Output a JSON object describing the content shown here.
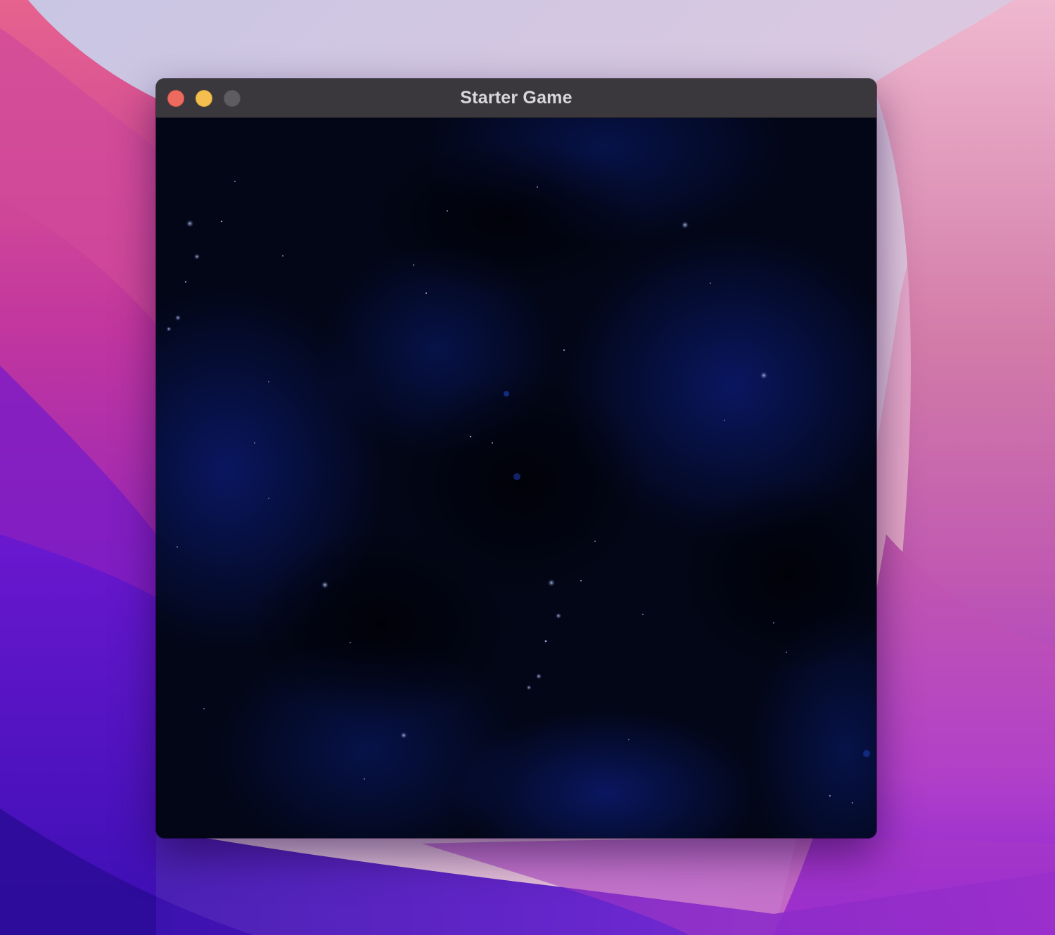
{
  "window": {
    "title": "Starter Game",
    "controls": {
      "close_color": "#ec6a5e",
      "minimize_color": "#f4bf4f",
      "zoom_color": "#5e5c60"
    }
  },
  "game": {
    "scene": "starfield-nebula",
    "background_color": "#020616",
    "nebula_color": "#0a1a6e"
  },
  "desktop": {
    "wallpaper": "purple-pink-gradient",
    "colors": [
      "#c9c6e2",
      "#e8a6c8",
      "#c04aa8",
      "#8a2ad0",
      "#4a14c4"
    ]
  }
}
